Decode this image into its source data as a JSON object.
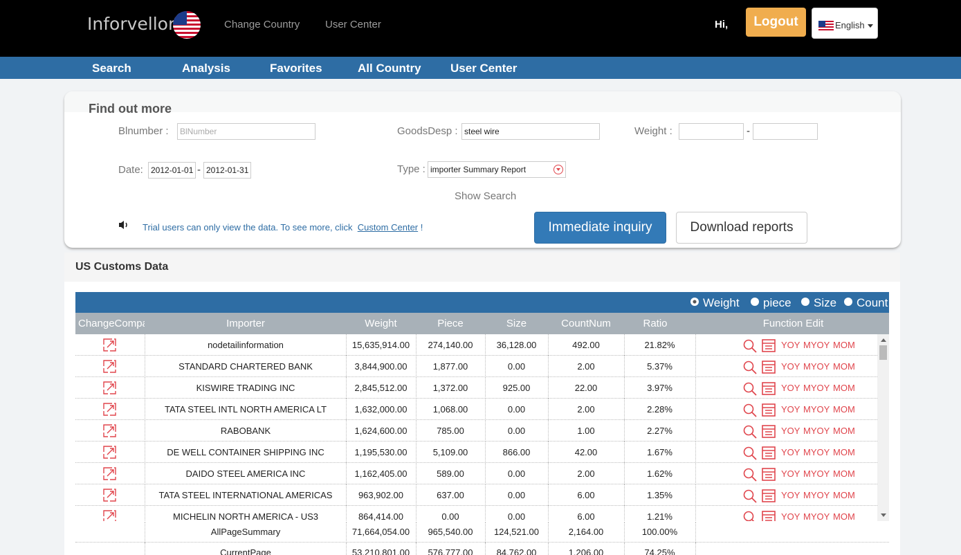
{
  "header": {
    "brand": "Inforvellor",
    "links": [
      "Change Country",
      "User Center"
    ],
    "greeting": "Hi,",
    "logout": "Logout",
    "language": "English"
  },
  "nav": [
    "Search",
    "Analysis",
    "Favorites",
    "All Country",
    "User Center"
  ],
  "search": {
    "title": "Find out more",
    "blnumber_label": "Blnumber  :",
    "blnumber_placeholder": "BlNumber",
    "goods_label": "GoodsDesp :",
    "goods_value": "steel wire",
    "weight_label": "Weight :",
    "weight_sep": "-",
    "date_label": "Date:",
    "date_from": "2012-01-01",
    "date_sep": "-",
    "date_to": "2012-01-31",
    "type_label": "Type :",
    "type_value": "importer Summary Report",
    "show_search": "Show Search",
    "notice": "Trial users can only view the data. To see more, click",
    "notice_link": "Custom Center",
    "notice_end": "!",
    "inquiry_button": "Immediate inquiry",
    "download_button": "Download reports"
  },
  "results": {
    "title": "US Customs Data",
    "radios": [
      "Weight",
      "piece",
      "Size",
      "Count"
    ],
    "headers": [
      "ChangeCompa",
      "Importer",
      "Weight",
      "Piece",
      "Size",
      "CountNum",
      "Ratio",
      "Function Edit"
    ],
    "functions": [
      "YOY",
      "MYOY",
      "MOM"
    ],
    "rows": [
      {
        "importer": "nodetailinformation",
        "weight": "15,635,914.00",
        "piece": "274,140.00",
        "size": "36,128.00",
        "count": "492.00",
        "ratio": "21.82%"
      },
      {
        "importer": "STANDARD CHARTERED BANK",
        "weight": "3,844,900.00",
        "piece": "1,877.00",
        "size": "0.00",
        "count": "2.00",
        "ratio": "5.37%"
      },
      {
        "importer": "KISWIRE TRADING INC",
        "weight": "2,845,512.00",
        "piece": "1,372.00",
        "size": "925.00",
        "count": "22.00",
        "ratio": "3.97%"
      },
      {
        "importer": "TATA STEEL INTL NORTH AMERICA LT",
        "weight": "1,632,000.00",
        "piece": "1,068.00",
        "size": "0.00",
        "count": "2.00",
        "ratio": "2.28%"
      },
      {
        "importer": "RABOBANK",
        "weight": "1,624,600.00",
        "piece": "785.00",
        "size": "0.00",
        "count": "1.00",
        "ratio": "2.27%"
      },
      {
        "importer": "DE WELL CONTAINER SHIPPING INC",
        "weight": "1,195,530.00",
        "piece": "5,109.00",
        "size": "866.00",
        "count": "42.00",
        "ratio": "1.67%"
      },
      {
        "importer": "DAIDO STEEL AMERICA INC",
        "weight": "1,162,405.00",
        "piece": "589.00",
        "size": "0.00",
        "count": "2.00",
        "ratio": "1.62%"
      },
      {
        "importer": "TATA STEEL INTERNATIONAL AMERICAS",
        "weight": "963,902.00",
        "piece": "637.00",
        "size": "0.00",
        "count": "6.00",
        "ratio": "1.35%"
      },
      {
        "importer": "MICHELIN NORTH AMERICA - US3",
        "weight": "864,414.00",
        "piece": "0.00",
        "size": "0.00",
        "count": "6.00",
        "ratio": "1.21%"
      }
    ],
    "summary": [
      {
        "label": "AllPageSummary",
        "weight": "71,664,054.00",
        "piece": "965,540.00",
        "size": "124,521.00",
        "count": "2,164.00",
        "ratio": "100.00%"
      },
      {
        "label": "CurrentPage",
        "weight": "53,210,801.00",
        "piece": "576,777.00",
        "size": "84,762.00",
        "count": "1,206.00",
        "ratio": "74.25%"
      }
    ]
  }
}
